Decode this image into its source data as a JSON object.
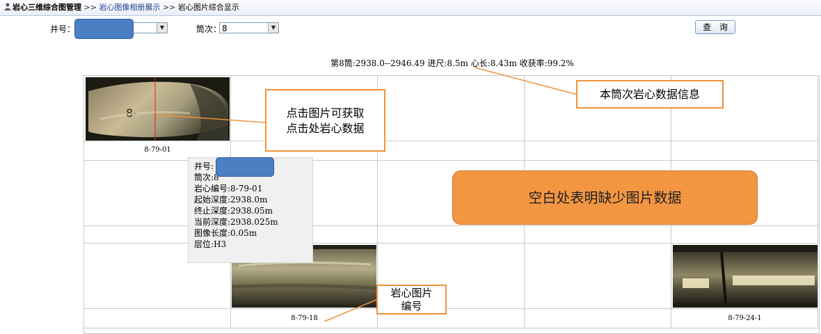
{
  "breadcrumb": {
    "root": "岩心三维综合图管理",
    "sep1": ">>",
    "link": "岩心图像相册展示",
    "sep2": ">>",
    "current": "岩心图片综合显示"
  },
  "filters": {
    "well_label": "井号：",
    "barrel_label": "筒次：",
    "barrel_value": "8",
    "query_label": "查 询"
  },
  "info_line": "第8筒:2938.0--2946.49 进尺:8.5m 心长:8.43m 收获率:99.2%",
  "cores": [
    {
      "caption": "8-79-01"
    },
    {
      "caption": "8-79-18"
    },
    {
      "caption": "8-79-24-1"
    }
  ],
  "tooltip": {
    "well": "井号:",
    "barrel": "筒次:8",
    "core_no": "岩心编号:8-79-01",
    "start_depth": "起始深度:2938.0m",
    "end_depth": "终止深度:2938.05m",
    "current_depth": "当前深度:2938.025m",
    "image_length": "图像长度:0.05m",
    "layer": "层位:H3"
  },
  "annotations": {
    "click_note_line1": "点击图片可获取",
    "click_note_line2": "点击处岩心数据",
    "barrel_info_note": "本筒次岩心数据信息",
    "missing_note": "空白处表明缺少图片数据",
    "image_no_line1": "岩心图片",
    "image_no_line2": "编号"
  },
  "colors": {
    "callout_border": "#f0923a",
    "missing_fill": "#f39642",
    "mask": "#4a7fc4",
    "link": "#1f3f8f"
  }
}
